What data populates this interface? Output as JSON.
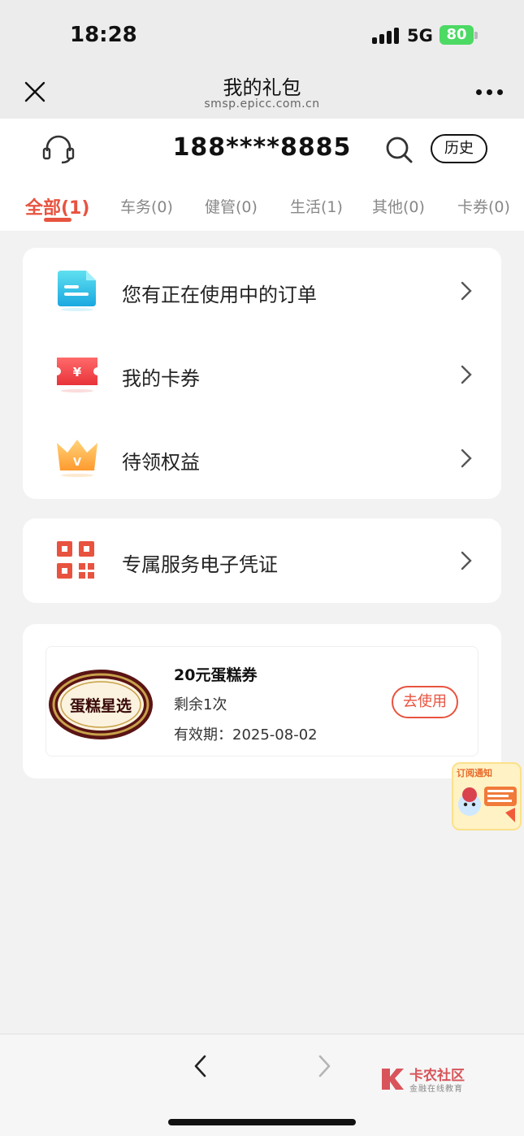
{
  "status": {
    "time": "18:28",
    "network": "5G",
    "battery": "80"
  },
  "nav": {
    "title": "我的礼包",
    "subtitle": "smsp.epicc.com.cn"
  },
  "header": {
    "phone": "188****8885",
    "history_label": "历史"
  },
  "tabs": [
    {
      "label": "全部(1)",
      "active": true
    },
    {
      "label": "车务(0)"
    },
    {
      "label": "健管(0)"
    },
    {
      "label": "生活(1)"
    },
    {
      "label": "其他(0)"
    },
    {
      "label": "卡券(0)"
    }
  ],
  "menu": {
    "items": [
      {
        "label": "您有正在使用中的订单",
        "icon": "document-icon"
      },
      {
        "label": "我的卡券",
        "icon": "ticket-icon"
      },
      {
        "label": "待领权益",
        "icon": "crown-icon"
      }
    ],
    "voucher": {
      "label": "专属服务电子凭证",
      "icon": "qrcode-icon"
    }
  },
  "coupon": {
    "logo_text": "蛋糕星选",
    "title": "20元蛋糕券",
    "remain": "剩余1次",
    "expiry": "有效期：2025-08-02",
    "action": "去使用"
  },
  "notice": {
    "title": "订阅通知"
  },
  "watermark": {
    "title": "卡农社区",
    "subtitle": "金融在线教育"
  },
  "colors": {
    "accent": "#e8533f",
    "battery": "#4cd964"
  }
}
